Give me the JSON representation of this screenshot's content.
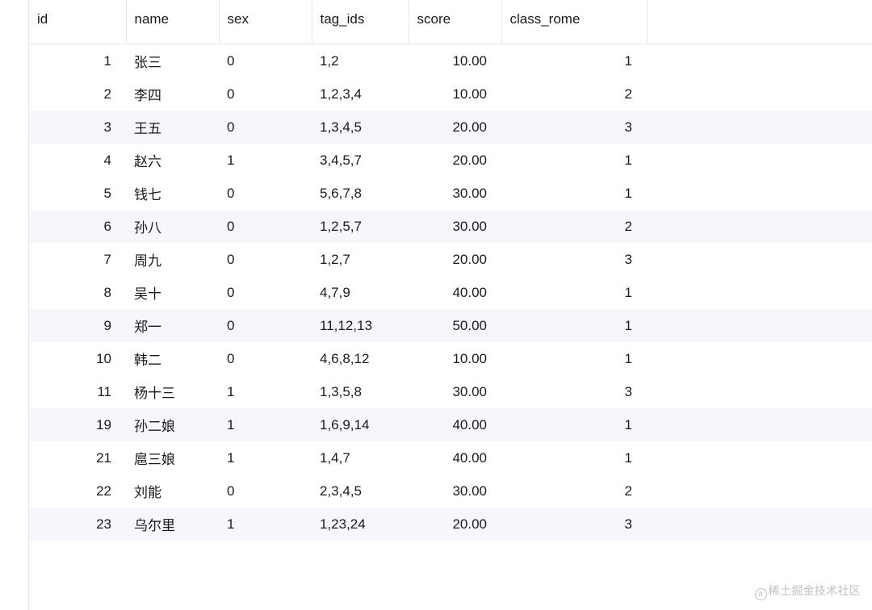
{
  "columns": {
    "id": "id",
    "name": "name",
    "sex": "sex",
    "tag_ids": "tag_ids",
    "score": "score",
    "class_rome": "class_rome"
  },
  "rows": [
    {
      "id": "1",
      "name": "张三",
      "sex": "0",
      "tag_ids": "1,2",
      "score": "10.00",
      "class_rome": "1"
    },
    {
      "id": "2",
      "name": "李四",
      "sex": "0",
      "tag_ids": "1,2,3,4",
      "score": "10.00",
      "class_rome": "2"
    },
    {
      "id": "3",
      "name": "王五",
      "sex": "0",
      "tag_ids": "1,3,4,5",
      "score": "20.00",
      "class_rome": "3"
    },
    {
      "id": "4",
      "name": "赵六",
      "sex": "1",
      "tag_ids": "3,4,5,7",
      "score": "20.00",
      "class_rome": "1"
    },
    {
      "id": "5",
      "name": "钱七",
      "sex": "0",
      "tag_ids": "5,6,7,8",
      "score": "30.00",
      "class_rome": "1"
    },
    {
      "id": "6",
      "name": "孙八",
      "sex": "0",
      "tag_ids": "1,2,5,7",
      "score": "30.00",
      "class_rome": "2"
    },
    {
      "id": "7",
      "name": "周九",
      "sex": "0",
      "tag_ids": "1,2,7",
      "score": "20.00",
      "class_rome": "3"
    },
    {
      "id": "8",
      "name": "吴十",
      "sex": "0",
      "tag_ids": "4,7,9",
      "score": "40.00",
      "class_rome": "1"
    },
    {
      "id": "9",
      "name": "郑一",
      "sex": "0",
      "tag_ids": "11,12,13",
      "score": "50.00",
      "class_rome": "1"
    },
    {
      "id": "10",
      "name": "韩二",
      "sex": "0",
      "tag_ids": "4,6,8,12",
      "score": "10.00",
      "class_rome": "1"
    },
    {
      "id": "11",
      "name": "杨十三",
      "sex": "1",
      "tag_ids": "1,3,5,8",
      "score": "30.00",
      "class_rome": "3"
    },
    {
      "id": "19",
      "name": "孙二娘",
      "sex": "1",
      "tag_ids": "1,6,9,14",
      "score": "40.00",
      "class_rome": "1"
    },
    {
      "id": "21",
      "name": "扈三娘",
      "sex": "1",
      "tag_ids": "1,4,7",
      "score": "40.00",
      "class_rome": "1"
    },
    {
      "id": "22",
      "name": "刘能",
      "sex": "0",
      "tag_ids": "2,3,4,5",
      "score": "30.00",
      "class_rome": "2"
    },
    {
      "id": "23",
      "name": "乌尔里",
      "sex": "1",
      "tag_ids": "1,23,24",
      "score": "20.00",
      "class_rome": "3"
    }
  ],
  "watermark": "稀土掘金技术社区"
}
